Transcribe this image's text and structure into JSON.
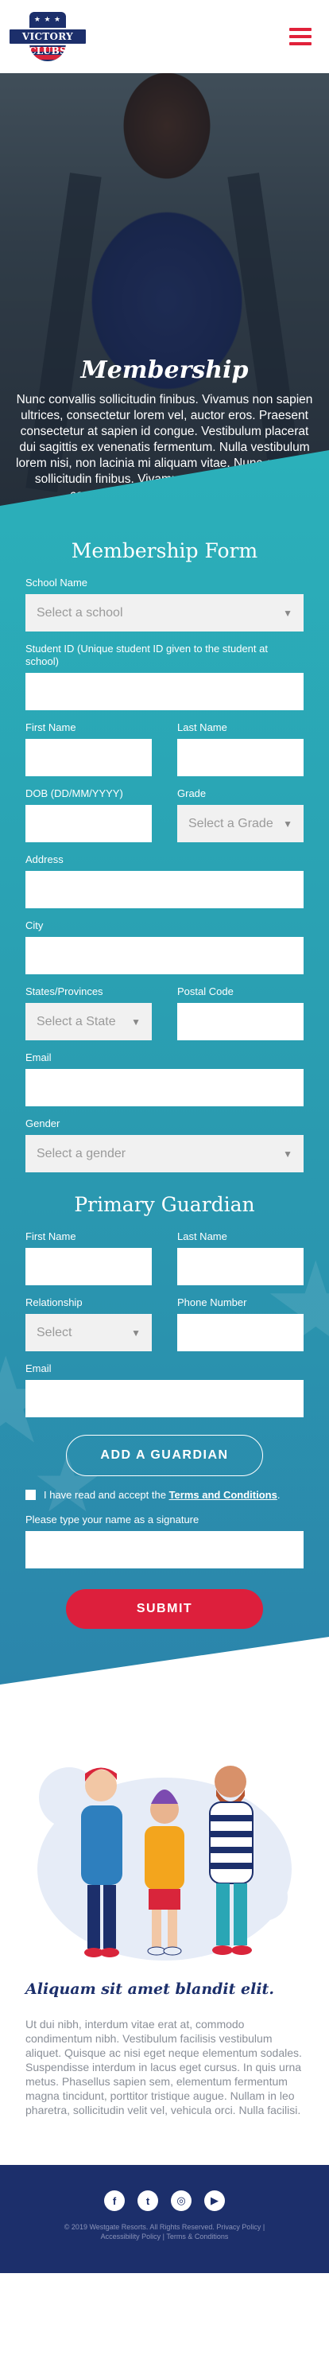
{
  "header": {
    "logo_text": "VICTORY CLUBS",
    "logo_stars": "★ ★ ★",
    "menu_icon": "hamburger-menu-icon"
  },
  "hero": {
    "title": "Membership",
    "body": "Nunc convallis sollicitudin finibus. Vivamus non sapien ultrices, consectetur lorem vel, auctor eros. Praesent consectetur at sapien id congue. Vestibulum placerat dui sagittis ex venenatis fermentum. Nulla vestibulum lorem nisi, non lacinia mi aliquam vitae. Nunc convallis sollicitudin finibus. Vivamus non sapien ultrices, consectetur lorem vel, auctor eros."
  },
  "form": {
    "title": "Membership Form",
    "school_label": "School Name",
    "school_placeholder": "Select a school",
    "student_id_label": "Student ID (Unique student ID given to the student at school)",
    "first_name_label": "First Name",
    "last_name_label": "Last Name",
    "dob_label": "DOB (DD/MM/YYYY)",
    "grade_label": "Grade",
    "grade_placeholder": "Select a Grade",
    "address_label": "Address",
    "city_label": "City",
    "state_label": "States/Provinces",
    "state_placeholder": "Select a State",
    "postal_label": "Postal Code",
    "email_label": "Email",
    "gender_label": "Gender",
    "gender_placeholder": "Select a gender"
  },
  "guardian": {
    "title": "Primary Guardian",
    "first_name_label": "First Name",
    "last_name_label": "Last Name",
    "relationship_label": "Relationship",
    "relationship_placeholder": "Select",
    "phone_label": "Phone Number",
    "email_label": "Email",
    "add_button": "ADD A GUARDIAN",
    "terms_prefix": "I have read and accept the",
    "terms_link": "Terms and Conditions",
    "terms_suffix": ".",
    "signature_label": "Please type your name as a signature",
    "submit_button": "SUBMIT"
  },
  "bottom": {
    "tagline": "Aliquam sit amet blandit elit.",
    "paragraph": "Ut dui nibh, interdum vitae erat at, commodo condimentum nibh. Vestibulum facilisis vestibulum aliquet. Quisque ac nisi eget neque elementum sodales. Suspendisse interdum in lacus eget cursus. In quis urna metus. Phasellus sapien sem, elementum fermentum magna tincidunt, porttitor tristique augue. Nullam in leo pharetra, sollicitudin velit vel, vehicula orci. Nulla facilisi."
  },
  "footer": {
    "social": [
      "facebook-icon",
      "twitter-icon",
      "instagram-icon",
      "youtube-icon"
    ],
    "social_glyphs": [
      "f",
      "t",
      "◎",
      "▶"
    ],
    "copyright": "© 2019 Westgate Resorts. All Rights Reserved. Privacy Policy | Accessibility Policy | Terms & Conditions"
  },
  "colors": {
    "navy": "#1c2f6b",
    "red": "#dd1f3c",
    "teal": "#2aa6b5"
  }
}
